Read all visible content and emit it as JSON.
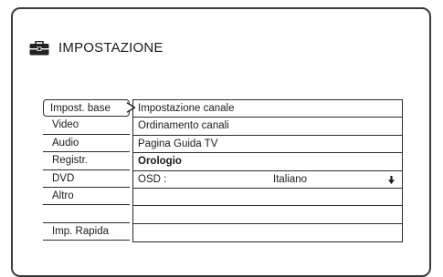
{
  "header": {
    "icon": "toolbox-icon",
    "title": "IMPOSTAZIONE"
  },
  "menu": {
    "items": [
      {
        "label": "Impost. base",
        "selected": true
      },
      {
        "label": "Video"
      },
      {
        "label": "Audio"
      },
      {
        "label": "Registr."
      },
      {
        "label": "DVD"
      },
      {
        "label": "Altro"
      },
      {
        "label": ""
      },
      {
        "label": "Imp. Rapida"
      }
    ]
  },
  "settings": {
    "rows": [
      {
        "label": "Impostazione canale"
      },
      {
        "label": "Ordinamento canali"
      },
      {
        "label": "Pagina Guida TV"
      },
      {
        "label": "Orologio"
      },
      {
        "label": "OSD :",
        "value": "Italiano",
        "icon": "arrow-down-icon"
      },
      {
        "label": ""
      },
      {
        "label": ""
      },
      {
        "label": ""
      }
    ]
  }
}
